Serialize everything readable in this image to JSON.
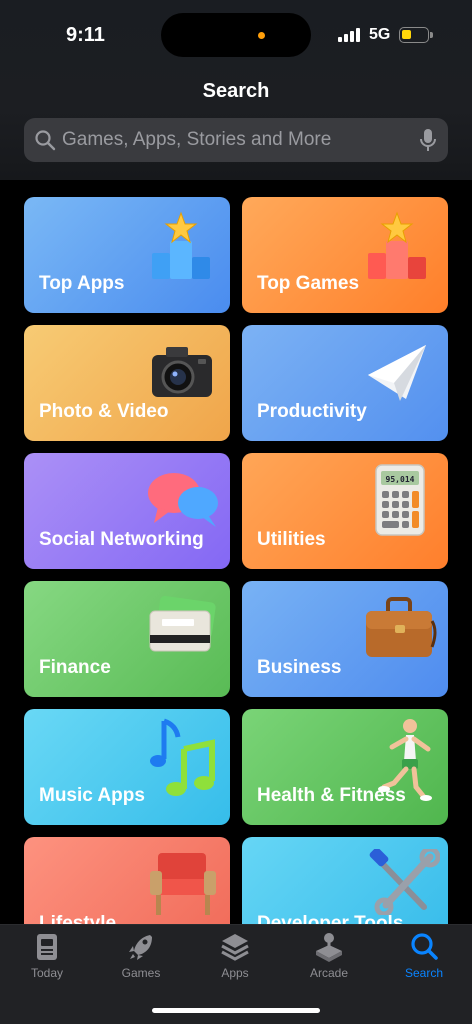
{
  "status_bar": {
    "time": "9:11",
    "network": "5G",
    "battery_level": 0.3,
    "battery_color": "#ffd60a",
    "privacy_dot_color": "#ff9f0a"
  },
  "header": {
    "title": "Search"
  },
  "search": {
    "placeholder": "Games, Apps, Stories and More",
    "icon": "magnifier-icon",
    "mic_icon": "microphone-icon"
  },
  "categories": [
    {
      "label": "Top Apps",
      "icon": "podium-blue-icon",
      "colors": [
        "#6aaef3",
        "#4c8ff0"
      ]
    },
    {
      "label": "Top Games",
      "icon": "podium-red-icon",
      "colors": [
        "#ff9f4a",
        "#ff7f2a"
      ]
    },
    {
      "label": "Photo & Video",
      "icon": "camera-icon",
      "colors": [
        "#f5c36b",
        "#f0a84c"
      ]
    },
    {
      "label": "Productivity",
      "icon": "paper-plane-icon",
      "colors": [
        "#6fa8f2",
        "#5590ef"
      ]
    },
    {
      "label": "Social Networking",
      "icon": "speech-bubbles-icon",
      "colors": [
        "#a487f5",
        "#8a6cf5"
      ]
    },
    {
      "label": "Utilities",
      "icon": "calculator-icon",
      "colors": [
        "#ff9d48",
        "#ff842f"
      ]
    },
    {
      "label": "Finance",
      "icon": "credit-card-icon",
      "colors": [
        "#7ed27a",
        "#5dbd59"
      ]
    },
    {
      "label": "Business",
      "icon": "briefcase-icon",
      "colors": [
        "#6eaaf2",
        "#528ff0"
      ]
    },
    {
      "label": "Music Apps",
      "icon": "music-notes-icon",
      "colors": [
        "#5fd3f3",
        "#38c0ec"
      ]
    },
    {
      "label": "Health & Fitness",
      "icon": "runner-icon",
      "colors": [
        "#72cc6f",
        "#56b954"
      ]
    },
    {
      "label": "Lifestyle",
      "icon": "armchair-icon",
      "colors": [
        "#fb8a7a",
        "#f26e5c"
      ]
    },
    {
      "label": "Developer Tools",
      "icon": "tools-icon",
      "colors": [
        "#5dd1f3",
        "#3bbfeb"
      ]
    }
  ],
  "calculator_display": "95,014",
  "tab_bar": {
    "tabs": [
      {
        "label": "Today",
        "icon": "today-icon",
        "active": false
      },
      {
        "label": "Games",
        "icon": "rocket-icon",
        "active": false
      },
      {
        "label": "Apps",
        "icon": "apps-stack-icon",
        "active": false
      },
      {
        "label": "Arcade",
        "icon": "joystick-icon",
        "active": false
      },
      {
        "label": "Search",
        "icon": "search-icon",
        "active": true
      }
    ],
    "active_color": "#0a84ff",
    "inactive_color": "#8e8e93"
  }
}
